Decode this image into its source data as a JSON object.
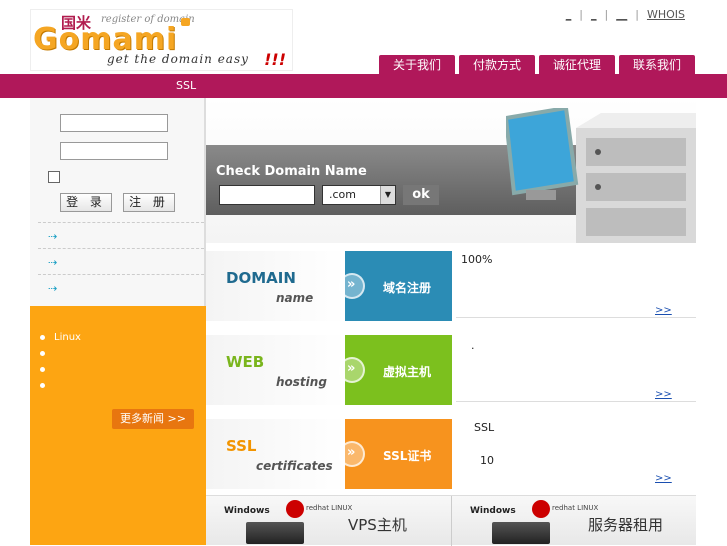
{
  "logo": {
    "cn": "国米",
    "tagline": "register of domain",
    "brand": "Gomami",
    "slogan": "get the domain easy",
    "bang": "!!!"
  },
  "toplinks": [
    {
      "label": "_"
    },
    {
      "label": "_"
    },
    {
      "label": "__"
    },
    {
      "label": "WHOIS"
    }
  ],
  "nav": {
    "tabs": [
      {
        "label": "关于我们"
      },
      {
        "label": "付款方式"
      },
      {
        "label": "诚征代理"
      },
      {
        "label": "联系我们"
      }
    ],
    "bar_item": "SSL"
  },
  "login": {
    "username_value": "",
    "password_value": "",
    "login_label": "登 录",
    "register_label": "注 册"
  },
  "news": {
    "items": [
      {
        "text": "Linux"
      },
      {
        "text": ""
      },
      {
        "text": ""
      },
      {
        "text": ""
      }
    ],
    "more_label": "更多新闻 >>"
  },
  "check": {
    "title": "Check Domain Name",
    "domain_value": "",
    "tld_selected": ".com",
    "ok_label": "ok"
  },
  "products": [
    {
      "big": "DOMAIN",
      "small": "name",
      "panel_label": "域名注册",
      "panel_color": "#2b8cb5",
      "big_color": "#1f6a8f",
      "lines": [
        "100%"
      ],
      "more": ">>"
    },
    {
      "big": "WEB",
      "small": "hosting",
      "panel_label": "虚拟主机",
      "panel_color": "#7cc01e",
      "big_color": "#7ab51d",
      "lines": [
        "."
      ],
      "more": ">>"
    },
    {
      "big": "SSL",
      "small": "certificates",
      "panel_label": "SSL证书",
      "panel_color": "#f7931e",
      "big_color": "#f29400",
      "lines": [
        "SSL",
        "10"
      ],
      "more": ">>"
    }
  ],
  "bottom": [
    {
      "win": "Windows",
      "linux": "redhat LINUX",
      "name": "VPS主机"
    },
    {
      "win": "Windows",
      "linux": "redhat LINUX",
      "name": "服务器租用"
    }
  ],
  "colors": {
    "brand": "#b0185a",
    "news_bg": "#fda512",
    "link": "#1a4fb0"
  }
}
